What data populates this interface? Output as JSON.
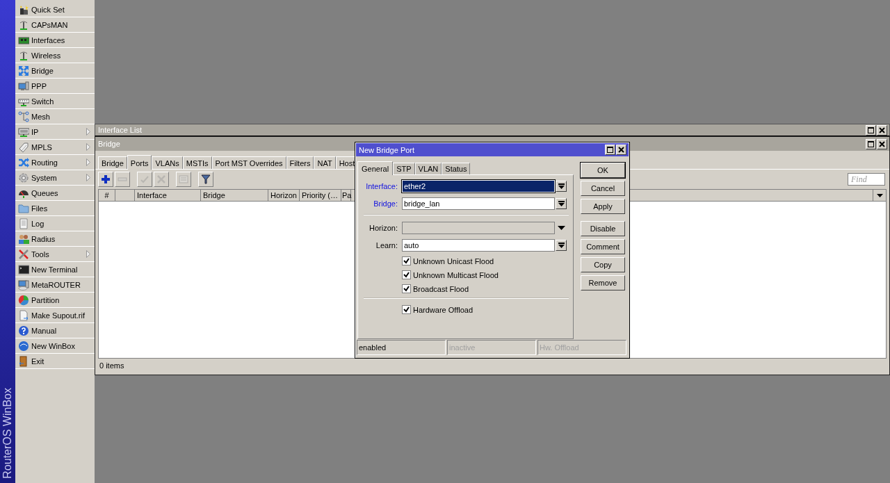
{
  "brand": "RouterOS WinBox",
  "menu": [
    {
      "label": "Quick Set",
      "submenu": false
    },
    {
      "label": "CAPsMAN",
      "submenu": false
    },
    {
      "label": "Interfaces",
      "submenu": false
    },
    {
      "label": "Wireless",
      "submenu": false
    },
    {
      "label": "Bridge",
      "submenu": false
    },
    {
      "label": "PPP",
      "submenu": false
    },
    {
      "label": "Switch",
      "submenu": false
    },
    {
      "label": "Mesh",
      "submenu": false
    },
    {
      "label": "IP",
      "submenu": true
    },
    {
      "label": "MPLS",
      "submenu": true
    },
    {
      "label": "Routing",
      "submenu": true
    },
    {
      "label": "System",
      "submenu": true
    },
    {
      "label": "Queues",
      "submenu": false
    },
    {
      "label": "Files",
      "submenu": false
    },
    {
      "label": "Log",
      "submenu": false
    },
    {
      "label": "Radius",
      "submenu": false
    },
    {
      "label": "Tools",
      "submenu": true
    },
    {
      "label": "New Terminal",
      "submenu": false
    },
    {
      "label": "MetaROUTER",
      "submenu": false
    },
    {
      "label": "Partition",
      "submenu": false
    },
    {
      "label": "Make Supout.rif",
      "submenu": false
    },
    {
      "label": "Manual",
      "submenu": false
    },
    {
      "label": "New WinBox",
      "submenu": false
    },
    {
      "label": "Exit",
      "submenu": false
    }
  ],
  "interface_list_window": {
    "title": "Interface List"
  },
  "bridge_window": {
    "title": "Bridge",
    "tabs": [
      {
        "label": "Bridge",
        "selected": false
      },
      {
        "label": "Ports",
        "selected": true
      },
      {
        "label": "VLANs",
        "selected": false
      },
      {
        "label": "MSTIs",
        "selected": false
      },
      {
        "label": "Port MST Overrides",
        "selected": false
      },
      {
        "label": "Filters",
        "selected": false
      },
      {
        "label": "NAT",
        "selected": false
      },
      {
        "label": "Host",
        "selected": false
      }
    ],
    "toolbar": [
      {
        "kind": "add",
        "disabled": false
      },
      {
        "kind": "remove",
        "disabled": true
      },
      {
        "kind": "enable",
        "disabled": true
      },
      {
        "kind": "disable",
        "disabled": true
      },
      {
        "kind": "comment",
        "disabled": true
      },
      {
        "kind": "filter",
        "disabled": false
      }
    ],
    "search": {
      "placeholder": "Find"
    },
    "table": {
      "columns": [
        "#",
        "Interface",
        "Bridge",
        "Horizon",
        "Priority (…",
        "Pa"
      ]
    },
    "status_bar": "0 items"
  },
  "dialog": {
    "title": "New Bridge Port",
    "tabs": [
      {
        "label": "General",
        "selected": true
      },
      {
        "label": "STP",
        "selected": false
      },
      {
        "label": "VLAN",
        "selected": false
      },
      {
        "label": "Status",
        "selected": false
      }
    ],
    "form": [
      {
        "kind": "select",
        "label": "Interface:",
        "value": "ether2",
        "required": true,
        "highlighted": true
      },
      {
        "kind": "select",
        "label": "Bridge:",
        "value": "bridge_lan",
        "required": true,
        "highlighted": false
      },
      {
        "kind": "separator"
      },
      {
        "kind": "optional",
        "label": "Horizon:",
        "disabled": true
      },
      {
        "kind": "select",
        "label": "Learn:",
        "value": "auto",
        "required": false,
        "highlighted": false
      },
      {
        "kind": "checkbox",
        "label": "Unknown Unicast Flood",
        "checked": true
      },
      {
        "kind": "checkbox",
        "label": "Unknown Multicast Flood",
        "checked": true
      },
      {
        "kind": "checkbox",
        "label": "Broadcast Flood",
        "checked": true
      },
      {
        "kind": "separator"
      },
      {
        "kind": "checkbox",
        "label": "Hardware Offload",
        "checked": true
      }
    ],
    "button_groups": [
      [
        {
          "label": "OK",
          "default": true
        },
        {
          "label": "Cancel",
          "default": false
        },
        {
          "label": "Apply",
          "default": false
        }
      ],
      [
        {
          "label": "Disable",
          "default": false
        },
        {
          "label": "Comment",
          "default": false
        },
        {
          "label": "Copy",
          "default": false
        },
        {
          "label": "Remove",
          "default": false
        }
      ]
    ],
    "status": [
      {
        "text": "enabled",
        "disabled": false
      },
      {
        "text": "inactive",
        "disabled": true
      },
      {
        "text": "Hw. Offload",
        "disabled": true
      }
    ]
  }
}
